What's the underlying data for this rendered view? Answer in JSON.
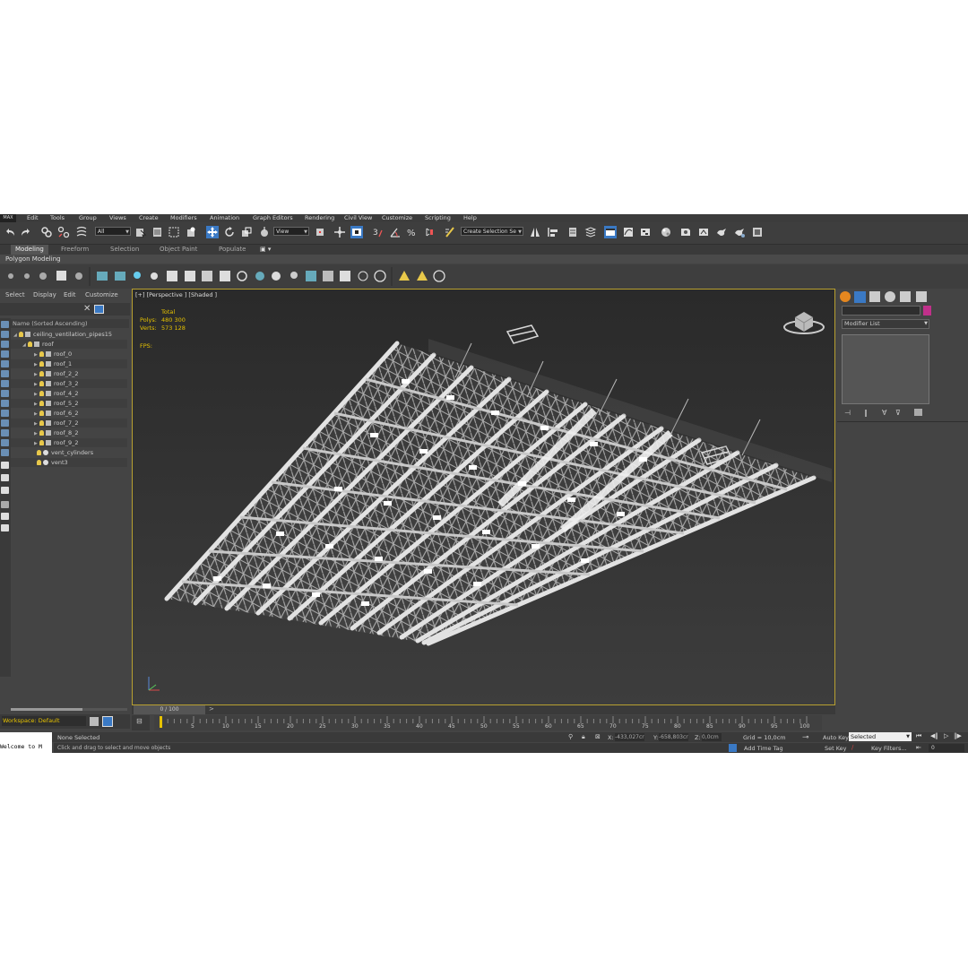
{
  "app": {
    "logo": "MAX"
  },
  "menu": [
    "Edit",
    "Tools",
    "Group",
    "Views",
    "Create",
    "Modifiers",
    "Animation",
    "Graph Editors",
    "Rendering",
    "Civil View",
    "Customize",
    "Scripting",
    "Help"
  ],
  "toolbar": {
    "filter_combo": "All",
    "coord_combo": "View",
    "selection_set_combo": "Create Selection Se"
  },
  "ribbon": {
    "tabs": [
      "Modeling",
      "Freeform",
      "Selection",
      "Object Paint",
      "Populate"
    ],
    "active_tab": "Modeling",
    "panel_label": "Polygon Modeling"
  },
  "explorer": {
    "tabs": [
      "Select",
      "Display",
      "Edit",
      "Customize"
    ],
    "column_header": "Name (Sorted Ascending)",
    "tree": [
      {
        "label": "ceiling_ventilation_pipes15",
        "indent": 0,
        "icon": "folder"
      },
      {
        "label": "roof",
        "indent": 1,
        "icon": "folder"
      },
      {
        "label": "roof_0",
        "indent": 2,
        "icon": "folder"
      },
      {
        "label": "roof_1",
        "indent": 2,
        "icon": "folder"
      },
      {
        "label": "roof_2_2",
        "indent": 2,
        "icon": "folder"
      },
      {
        "label": "roof_3_2",
        "indent": 2,
        "icon": "folder"
      },
      {
        "label": "roof_4_2",
        "indent": 2,
        "icon": "folder"
      },
      {
        "label": "roof_5_2",
        "indent": 2,
        "icon": "folder"
      },
      {
        "label": "roof_6_2",
        "indent": 2,
        "icon": "folder"
      },
      {
        "label": "roof_7_2",
        "indent": 2,
        "icon": "folder"
      },
      {
        "label": "roof_8_2",
        "indent": 2,
        "icon": "folder"
      },
      {
        "label": "roof_9_2",
        "indent": 2,
        "icon": "folder"
      },
      {
        "label": "vent_cylinders",
        "indent": 1,
        "icon": "sphere"
      },
      {
        "label": "vent3",
        "indent": 1,
        "icon": "sphere"
      }
    ],
    "workspace": "Workspace: Default"
  },
  "viewport": {
    "label": "[+] [Perspective ] [Shaded ]",
    "stats_title": "Total",
    "polys_label": "Polys:",
    "polys_value": "480 300",
    "verts_label": "Verts:",
    "verts_value": "573 128",
    "fps_label": "FPS:"
  },
  "command_panel": {
    "modifier_list": "Modifier List"
  },
  "timeline": {
    "slider_label": "0 / 100",
    "ticks": [
      "5",
      "10",
      "15",
      "20",
      "25",
      "30",
      "35",
      "40",
      "45",
      "50",
      "55",
      "60",
      "65",
      "70",
      "75",
      "80",
      "85",
      "90",
      "95",
      "100"
    ]
  },
  "status": {
    "maxscript": "Welcome to M",
    "selection": "None Selected",
    "prompt": "Click and drag to select and move objects",
    "x_label": "X:",
    "x_value": "-433,027cr",
    "y_label": "Y:",
    "y_value": "-658,803cr",
    "z_label": "Z:",
    "z_value": "0,0cm",
    "grid": "Grid = 10,0cm",
    "add_time_tag": "Add Time Tag",
    "auto_key": "Auto Key",
    "set_key": "Set Key",
    "key_mode": "Selected",
    "key_filters": "Key Filters...",
    "frame": "0"
  },
  "colors": {
    "viewport_border": "#b8a030",
    "stats": "#e6c200",
    "accent_blue": "#3a79c4"
  }
}
